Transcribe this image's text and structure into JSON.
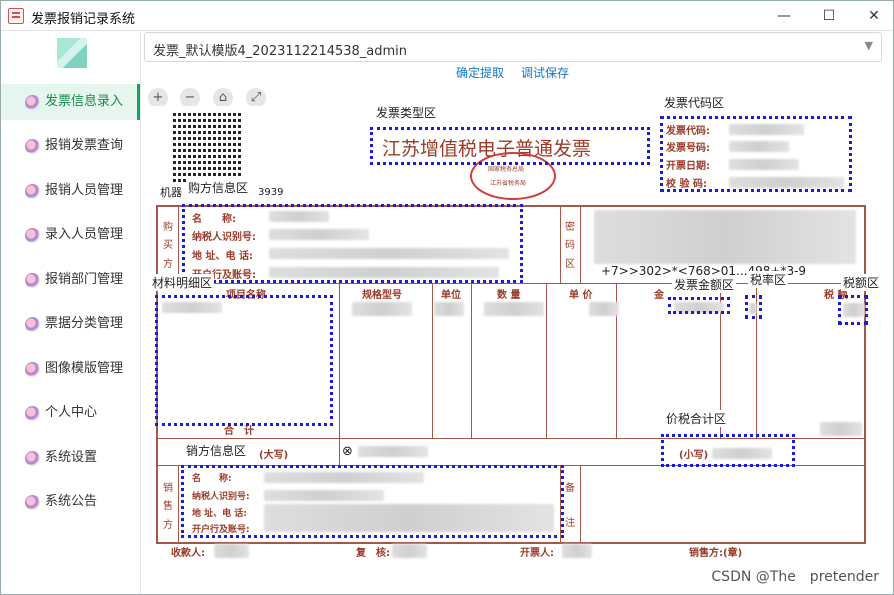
{
  "window": {
    "title": "发票报销记录系统",
    "controls": [
      "—",
      "☐",
      "✕"
    ]
  },
  "sidebar": {
    "items": [
      {
        "label": "发票信息录入",
        "active": true
      },
      {
        "label": "报销发票查询"
      },
      {
        "label": "报销人员管理"
      },
      {
        "label": "录入人员管理"
      },
      {
        "label": "报销部门管理"
      },
      {
        "label": "票据分类管理"
      },
      {
        "label": "图像模版管理"
      },
      {
        "label": "个人中心"
      },
      {
        "label": "系统设置"
      },
      {
        "label": "系统公告"
      }
    ]
  },
  "template_select": {
    "value": "发票_默认模版4_2023112214538_admin"
  },
  "actions": {
    "confirm": "确定提取",
    "debug_save": "调试保存"
  },
  "zoom_tools": [
    "+",
    "−",
    "⌂",
    "⤢"
  ],
  "invoice": {
    "title": "江苏增值税电子普通发票",
    "stamp_lines": [
      "国家税务总局",
      "江苏省税务局"
    ],
    "machine_label": "机器",
    "machine_num": "3939",
    "code_fields": [
      "发票代码:",
      "发票号码:",
      "开票日期:",
      "校 验 码:"
    ],
    "buyer_side": [
      "购",
      "买",
      "方"
    ],
    "buyer_fields": [
      "名　　称:",
      "纳税人识别号:",
      "地 址、电 话:",
      "开户行及账号:"
    ],
    "password_side": [
      "密",
      "码",
      "区"
    ],
    "password_text": "+7>>302>*<768>01...498+*3-9",
    "table_headers": [
      "项目名称",
      "规格型号",
      "单位",
      "数 量",
      "单 价",
      "金",
      "税率",
      "税 额"
    ],
    "total_label": "合　计",
    "total_words_label": "(大写)",
    "total_small_label": "(小写)",
    "seller_side": [
      "销",
      "售",
      "方"
    ],
    "seller_fields": [
      "名　　称:",
      "纳税人识别号:",
      "地 址、电 话:",
      "开户行及账号:"
    ],
    "remark_side": [
      "备",
      "注"
    ],
    "footer": [
      "收款人:",
      "复　核:",
      "开票人:",
      "销售方:(章)"
    ]
  },
  "regions": {
    "type": "发票类型区",
    "code": "发票代码区",
    "buyer": "购方信息区",
    "items": "材料明细区",
    "amount": "发票金额区",
    "rate": "税率区",
    "tax": "税额区",
    "total": "价税合计区",
    "seller": "销方信息区"
  },
  "watermark": "CSDN @The　pretender"
}
